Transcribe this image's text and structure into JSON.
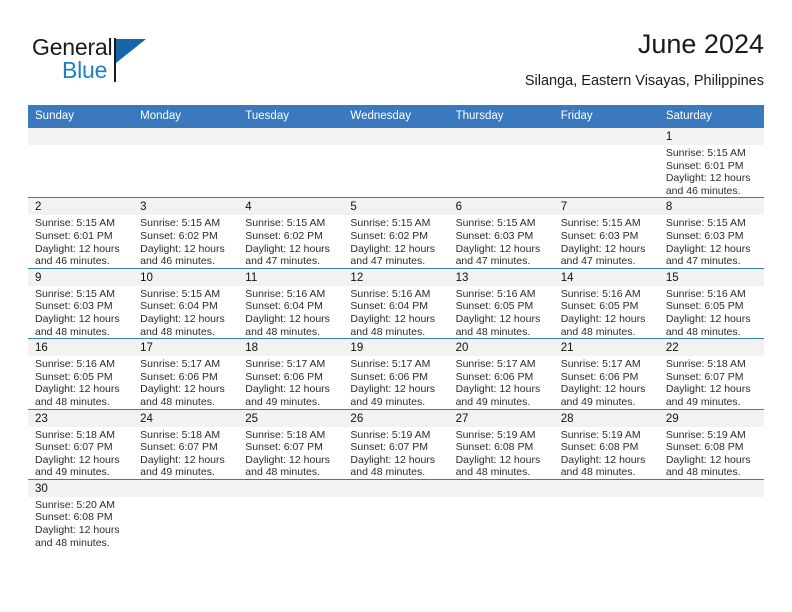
{
  "brand": {
    "name_top": "General",
    "name_bottom": "Blue",
    "accent_color": "#1565a8",
    "blue_text_color": "#1f7fc4"
  },
  "header": {
    "title": "June 2024",
    "subtitle": "Silanga, Eastern Visayas, Philippines"
  },
  "calendar": {
    "header_bg": "#3a79bd",
    "daynum_bg": "#f2f2f2",
    "weekdays": [
      "Sunday",
      "Monday",
      "Tuesday",
      "Wednesday",
      "Thursday",
      "Friday",
      "Saturday"
    ],
    "weeks": [
      [
        {
          "day": "",
          "empty": true
        },
        {
          "day": "",
          "empty": true
        },
        {
          "day": "",
          "empty": true
        },
        {
          "day": "",
          "empty": true
        },
        {
          "day": "",
          "empty": true
        },
        {
          "day": "",
          "empty": true
        },
        {
          "day": "1",
          "sunrise": "Sunrise: 5:15 AM",
          "sunset": "Sunset: 6:01 PM",
          "daylight1": "Daylight: 12 hours",
          "daylight2": "and 46 minutes."
        }
      ],
      [
        {
          "day": "2",
          "sunrise": "Sunrise: 5:15 AM",
          "sunset": "Sunset: 6:01 PM",
          "daylight1": "Daylight: 12 hours",
          "daylight2": "and 46 minutes."
        },
        {
          "day": "3",
          "sunrise": "Sunrise: 5:15 AM",
          "sunset": "Sunset: 6:02 PM",
          "daylight1": "Daylight: 12 hours",
          "daylight2": "and 46 minutes."
        },
        {
          "day": "4",
          "sunrise": "Sunrise: 5:15 AM",
          "sunset": "Sunset: 6:02 PM",
          "daylight1": "Daylight: 12 hours",
          "daylight2": "and 47 minutes."
        },
        {
          "day": "5",
          "sunrise": "Sunrise: 5:15 AM",
          "sunset": "Sunset: 6:02 PM",
          "daylight1": "Daylight: 12 hours",
          "daylight2": "and 47 minutes."
        },
        {
          "day": "6",
          "sunrise": "Sunrise: 5:15 AM",
          "sunset": "Sunset: 6:03 PM",
          "daylight1": "Daylight: 12 hours",
          "daylight2": "and 47 minutes."
        },
        {
          "day": "7",
          "sunrise": "Sunrise: 5:15 AM",
          "sunset": "Sunset: 6:03 PM",
          "daylight1": "Daylight: 12 hours",
          "daylight2": "and 47 minutes."
        },
        {
          "day": "8",
          "sunrise": "Sunrise: 5:15 AM",
          "sunset": "Sunset: 6:03 PM",
          "daylight1": "Daylight: 12 hours",
          "daylight2": "and 47 minutes."
        }
      ],
      [
        {
          "day": "9",
          "sunrise": "Sunrise: 5:15 AM",
          "sunset": "Sunset: 6:03 PM",
          "daylight1": "Daylight: 12 hours",
          "daylight2": "and 48 minutes."
        },
        {
          "day": "10",
          "sunrise": "Sunrise: 5:15 AM",
          "sunset": "Sunset: 6:04 PM",
          "daylight1": "Daylight: 12 hours",
          "daylight2": "and 48 minutes."
        },
        {
          "day": "11",
          "sunrise": "Sunrise: 5:16 AM",
          "sunset": "Sunset: 6:04 PM",
          "daylight1": "Daylight: 12 hours",
          "daylight2": "and 48 minutes."
        },
        {
          "day": "12",
          "sunrise": "Sunrise: 5:16 AM",
          "sunset": "Sunset: 6:04 PM",
          "daylight1": "Daylight: 12 hours",
          "daylight2": "and 48 minutes."
        },
        {
          "day": "13",
          "sunrise": "Sunrise: 5:16 AM",
          "sunset": "Sunset: 6:05 PM",
          "daylight1": "Daylight: 12 hours",
          "daylight2": "and 48 minutes."
        },
        {
          "day": "14",
          "sunrise": "Sunrise: 5:16 AM",
          "sunset": "Sunset: 6:05 PM",
          "daylight1": "Daylight: 12 hours",
          "daylight2": "and 48 minutes."
        },
        {
          "day": "15",
          "sunrise": "Sunrise: 5:16 AM",
          "sunset": "Sunset: 6:05 PM",
          "daylight1": "Daylight: 12 hours",
          "daylight2": "and 48 minutes."
        }
      ],
      [
        {
          "day": "16",
          "sunrise": "Sunrise: 5:16 AM",
          "sunset": "Sunset: 6:05 PM",
          "daylight1": "Daylight: 12 hours",
          "daylight2": "and 48 minutes."
        },
        {
          "day": "17",
          "sunrise": "Sunrise: 5:17 AM",
          "sunset": "Sunset: 6:06 PM",
          "daylight1": "Daylight: 12 hours",
          "daylight2": "and 48 minutes."
        },
        {
          "day": "18",
          "sunrise": "Sunrise: 5:17 AM",
          "sunset": "Sunset: 6:06 PM",
          "daylight1": "Daylight: 12 hours",
          "daylight2": "and 49 minutes."
        },
        {
          "day": "19",
          "sunrise": "Sunrise: 5:17 AM",
          "sunset": "Sunset: 6:06 PM",
          "daylight1": "Daylight: 12 hours",
          "daylight2": "and 49 minutes."
        },
        {
          "day": "20",
          "sunrise": "Sunrise: 5:17 AM",
          "sunset": "Sunset: 6:06 PM",
          "daylight1": "Daylight: 12 hours",
          "daylight2": "and 49 minutes."
        },
        {
          "day": "21",
          "sunrise": "Sunrise: 5:17 AM",
          "sunset": "Sunset: 6:06 PM",
          "daylight1": "Daylight: 12 hours",
          "daylight2": "and 49 minutes."
        },
        {
          "day": "22",
          "sunrise": "Sunrise: 5:18 AM",
          "sunset": "Sunset: 6:07 PM",
          "daylight1": "Daylight: 12 hours",
          "daylight2": "and 49 minutes."
        }
      ],
      [
        {
          "day": "23",
          "sunrise": "Sunrise: 5:18 AM",
          "sunset": "Sunset: 6:07 PM",
          "daylight1": "Daylight: 12 hours",
          "daylight2": "and 49 minutes."
        },
        {
          "day": "24",
          "sunrise": "Sunrise: 5:18 AM",
          "sunset": "Sunset: 6:07 PM",
          "daylight1": "Daylight: 12 hours",
          "daylight2": "and 49 minutes."
        },
        {
          "day": "25",
          "sunrise": "Sunrise: 5:18 AM",
          "sunset": "Sunset: 6:07 PM",
          "daylight1": "Daylight: 12 hours",
          "daylight2": "and 48 minutes."
        },
        {
          "day": "26",
          "sunrise": "Sunrise: 5:19 AM",
          "sunset": "Sunset: 6:07 PM",
          "daylight1": "Daylight: 12 hours",
          "daylight2": "and 48 minutes."
        },
        {
          "day": "27",
          "sunrise": "Sunrise: 5:19 AM",
          "sunset": "Sunset: 6:08 PM",
          "daylight1": "Daylight: 12 hours",
          "daylight2": "and 48 minutes."
        },
        {
          "day": "28",
          "sunrise": "Sunrise: 5:19 AM",
          "sunset": "Sunset: 6:08 PM",
          "daylight1": "Daylight: 12 hours",
          "daylight2": "and 48 minutes."
        },
        {
          "day": "29",
          "sunrise": "Sunrise: 5:19 AM",
          "sunset": "Sunset: 6:08 PM",
          "daylight1": "Daylight: 12 hours",
          "daylight2": "and 48 minutes."
        }
      ],
      [
        {
          "day": "30",
          "sunrise": "Sunrise: 5:20 AM",
          "sunset": "Sunset: 6:08 PM",
          "daylight1": "Daylight: 12 hours",
          "daylight2": "and 48 minutes."
        },
        {
          "day": "",
          "empty": true
        },
        {
          "day": "",
          "empty": true
        },
        {
          "day": "",
          "empty": true
        },
        {
          "day": "",
          "empty": true
        },
        {
          "day": "",
          "empty": true
        },
        {
          "day": "",
          "empty": true
        }
      ]
    ]
  }
}
